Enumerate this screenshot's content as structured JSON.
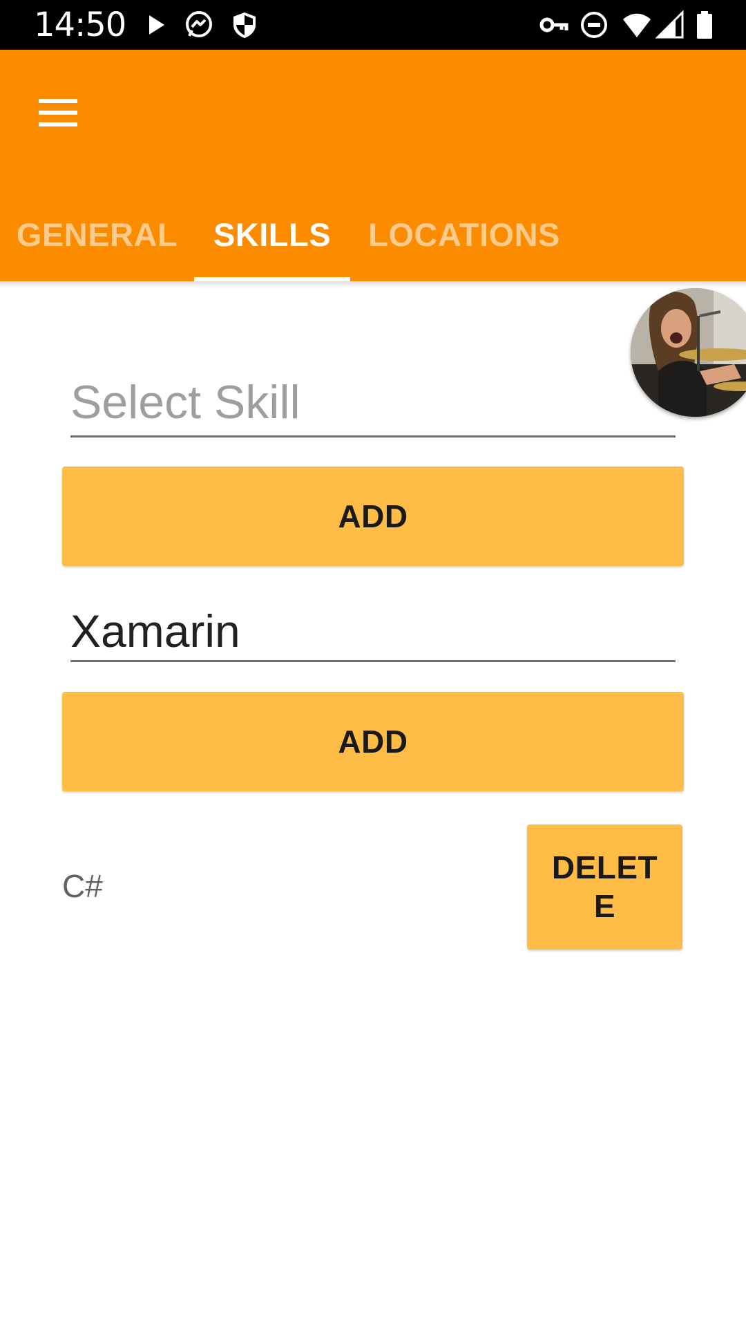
{
  "status_bar": {
    "time": "14:50",
    "left_icons": [
      "play-icon",
      "messenger-icon",
      "shield-icon"
    ],
    "right_icons": [
      "vpn-key-icon",
      "do-not-disturb-icon",
      "wifi-icon",
      "signal-icon",
      "battery-icon"
    ]
  },
  "app_bar": {
    "color": "#FB8C00",
    "menu_icon": "hamburger-menu-icon"
  },
  "tabs": [
    {
      "label": "GENERAL",
      "selected": false
    },
    {
      "label": "SKILLS",
      "selected": true
    },
    {
      "label": "LOCATIONS",
      "selected": false
    }
  ],
  "skills_form": {
    "select_skill_placeholder": "Select Skill",
    "add_label_1": "ADD",
    "custom_skill_value": "Xamarin",
    "add_label_2": "ADD"
  },
  "skills_list": [
    {
      "name": "C#",
      "delete_line_1": "DELET",
      "delete_line_2": "E"
    }
  ],
  "colors": {
    "accent_button": "#FFBC47",
    "tab_inactive": "#FDCB8C"
  }
}
